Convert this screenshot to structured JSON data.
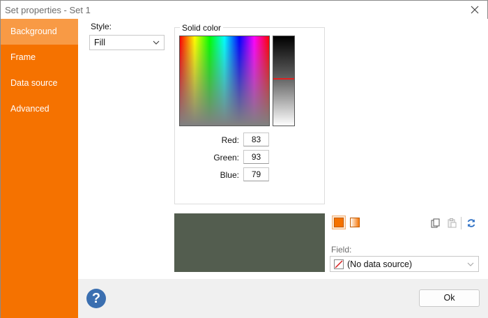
{
  "window": {
    "title": "Set properties - Set 1"
  },
  "sidebar": {
    "items": [
      {
        "label": "Background",
        "active": true
      },
      {
        "label": "Frame",
        "active": false
      },
      {
        "label": "Data source",
        "active": false
      },
      {
        "label": "Advanced",
        "active": false
      }
    ]
  },
  "style": {
    "label": "Style:",
    "value": "Fill"
  },
  "solid_color": {
    "title": "Solid color",
    "red_label": "Red:",
    "red": "83",
    "green_label": "Green:",
    "green": "93",
    "blue_label": "Blue:",
    "blue": "79",
    "preview_color": "#535d4f"
  },
  "field": {
    "label": "Field:",
    "value": "(No data source)"
  },
  "footer": {
    "ok_label": "Ok",
    "help_glyph": "?"
  },
  "colors": {
    "accent": "#f57200",
    "sidebar_active": "#f89a45"
  }
}
